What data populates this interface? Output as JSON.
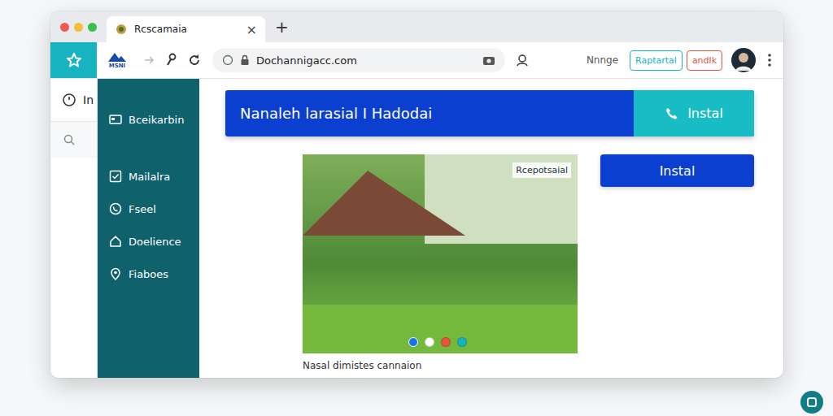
{
  "window": {
    "tab_title": "Rcscamaia",
    "tab_close": "×",
    "new_tab": "+"
  },
  "toolbar": {
    "logo": "MSNI",
    "url": "Dochannigacc.com",
    "menu_text": "Nnnge",
    "buttons": [
      {
        "label": "Raptartal",
        "color": "#17b3c0"
      },
      {
        "label": "andlk",
        "color": "#e0553f"
      }
    ]
  },
  "left_strip": {
    "label": "In"
  },
  "sidebar": {
    "items": [
      {
        "label": "Bceikarbin",
        "icon": "card"
      },
      {
        "label": "Mailalra",
        "icon": "check"
      },
      {
        "label": "Fseel",
        "icon": "phone"
      },
      {
        "label": "Doelience",
        "icon": "home"
      },
      {
        "label": "Fiaboes",
        "icon": "pin"
      }
    ]
  },
  "banner": {
    "title": "Nanaleh larasial I Hadodai",
    "button": "Instal"
  },
  "gallery": {
    "badge": "Rcepotsaial",
    "caption": "Nasal dimistes cannaion",
    "dots": [
      {
        "selected": true,
        "color": "#1a73e8"
      },
      {
        "selected": false,
        "color": "#ffffff"
      },
      {
        "selected": false,
        "color": "#e8553f"
      },
      {
        "selected": false,
        "color": "#17b3c0"
      }
    ]
  },
  "side_button": {
    "label": "Instal"
  }
}
